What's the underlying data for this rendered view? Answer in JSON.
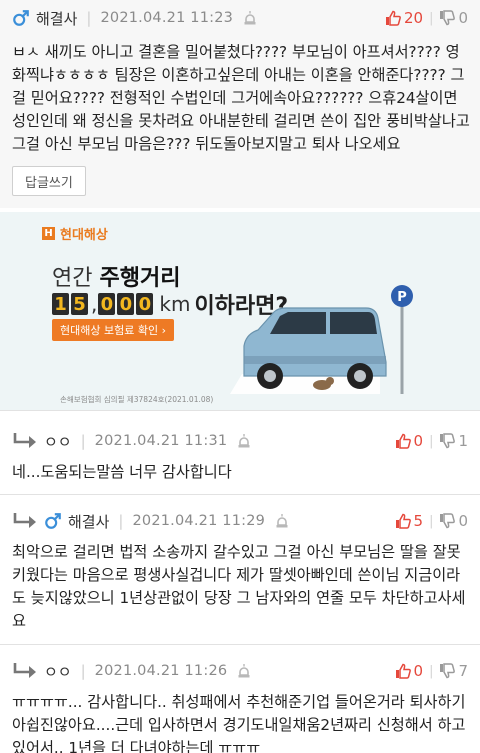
{
  "comments": [
    {
      "author": "해결사",
      "date": "2021.04.21 11:23",
      "upvotes": "20",
      "downvotes": "0",
      "is_reply": false,
      "text": "ㅂㅅ 새끼도 아니고 결혼을 밀어붙쳤다???? 부모님이 아프셔서???? 영화찍냐ㅎㅎㅎㅎ 팀장은 이혼하고싶은데 아내는 이혼을 안해준다???? 그걸 믿어요???? 전형적인 수법인데 그거에속아요?????? 으휴24살이면 성인인데 왜 정신을 못차려요 아내분한테 걸리면 쓴이 집안 풍비박살나고 그걸 아신 부모님 마음은??? 뒤도돌아보지말고 퇴사 나오세요",
      "reply_button": "답글쓰기"
    },
    {
      "author": "ㅇㅇ",
      "date": "2021.04.21 11:31",
      "upvotes": "0",
      "downvotes": "1",
      "is_reply": true,
      "text": "네...도움되는말씀 너무 감사합니다"
    },
    {
      "author": "해결사",
      "date": "2021.04.21 11:29",
      "upvotes": "5",
      "downvotes": "0",
      "is_reply": true,
      "text": "최악으로 걸리면 법적 소송까지 갈수있고 그걸 아신 부모님은 딸을 잘못키웠다는 마음으로 평생사실겁니다 제가 딸셋아빠인데 쓴이님 지금이라도 늦지않았으니 1년상관없이 당장 그 남자와의 연줄 모두 차단하고사세요"
    },
    {
      "author": "ㅇㅇ",
      "date": "2021.04.21 11:26",
      "upvotes": "0",
      "downvotes": "7",
      "is_reply": true,
      "text": "ㅠㅠㅠㅠ... 감사합니다.. 취성패에서 추천해준기업 들어온거라 퇴사하기 아쉽진않아요....근데 입사하면서 경기도내일채움2년짜리 신청해서 하고있어서.. 1년을 더 다녀야하는데 ㅠㅠㅠ"
    }
  ],
  "ad": {
    "brand": "현대해상",
    "line1_prefix": "연간",
    "line1_bold": "주행거리",
    "digits_a": [
      "1",
      "5"
    ],
    "comma": ",",
    "digits_b": [
      "0",
      "0",
      "0"
    ],
    "unit": "km",
    "line2_tail": "이하라면?",
    "cta": "현대해상 보험료 확인 ›",
    "small_print": "손해보험협회 심의필 제37824호(2021.01.08)",
    "parking_sign": "P"
  },
  "colors": {
    "upvote": "#e5483c",
    "downvote": "#9a9a9a",
    "male_icon": "#3b8fd9",
    "ad_accent": "#ea7b1f",
    "ad_bg": "#eef5f6"
  },
  "icons": [
    "reply-arrow-icon",
    "male-icon",
    "report-icon",
    "thumb-up-icon",
    "thumb-down-icon",
    "parking-icon"
  ]
}
